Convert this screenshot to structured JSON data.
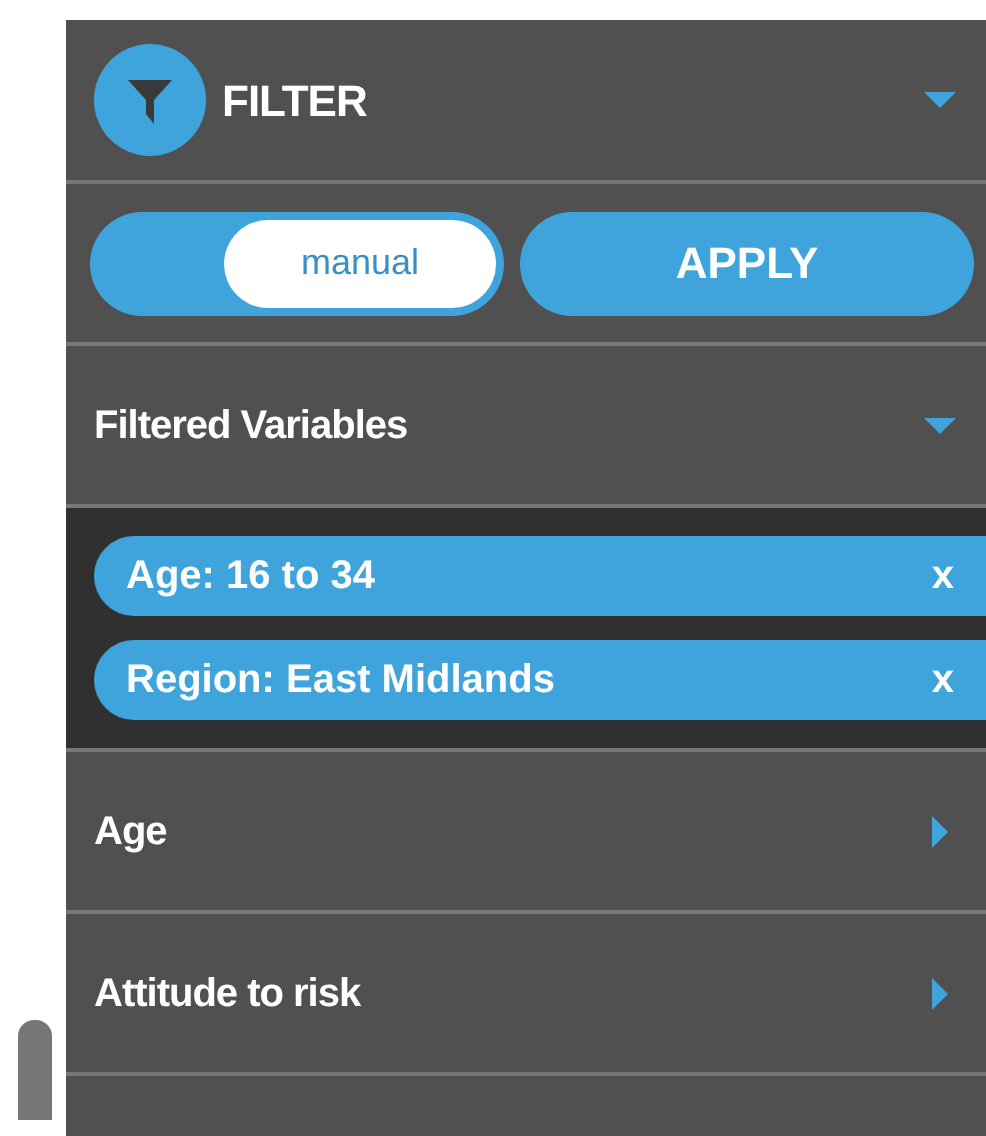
{
  "header": {
    "title": "FILTER",
    "expanded": true
  },
  "mode": {
    "label": "manual",
    "on": true
  },
  "apply_button": "APPLY",
  "filtered_variables": {
    "title": "Filtered Variables",
    "expanded": true,
    "chips": [
      {
        "label": "Age: 16 to 34",
        "remove": "x"
      },
      {
        "label": "Region: East Midlands",
        "remove": "x"
      }
    ]
  },
  "sections": [
    {
      "title": "Age",
      "expanded": false
    },
    {
      "title": "Attitude to risk",
      "expanded": false
    }
  ]
}
